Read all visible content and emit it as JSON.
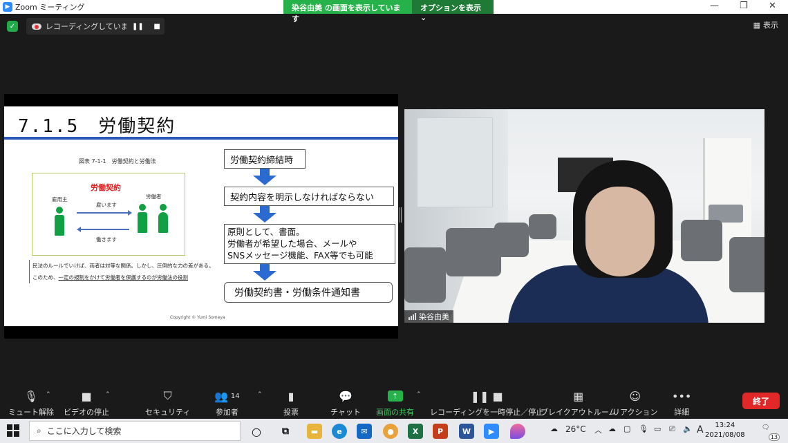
{
  "window": {
    "title": "Zoom ミーティング"
  },
  "share_banner": {
    "who": "染谷由美 の画面を表示しています",
    "options": "オプションを表示"
  },
  "window_controls": {
    "minimize": "—",
    "maximize": "❐",
    "close": "✕"
  },
  "recording": {
    "label": "レコーディングしています...",
    "pause": "❚❚",
    "stop": "■"
  },
  "view": {
    "label": "表示"
  },
  "slide": {
    "title": "7.1.5　労働契約",
    "figure_caption": "図表 7-1-1　労働契約と労働法",
    "contract_label": "労働契約",
    "employer": "雇用主",
    "worker": "労働者",
    "hire": "雇います",
    "work": "働きます",
    "note_line1": "民法のルールでいけば、両者は対等な関係。しかし、圧倒的な力の差がある。",
    "note_line2_prefix": "このため、",
    "note_line2_underline": "一定の規制をかけて労働者を保護するのが労働法の役割",
    "copyright": "Copyright © Yumi Someya",
    "flow": {
      "step1": "労働契約締結時",
      "step2": "契約内容を明示しなければならない",
      "step3_line1": "原則として、書面。",
      "step3_line2": "労働者が希望した場合、メールや",
      "step3_line3": "SNSメッセージ機能、FAX等でも可能",
      "step4": "労働契約書・労働条件通知書"
    }
  },
  "video": {
    "name": "染谷由美"
  },
  "toolbar": {
    "mute": "ミュート解除",
    "video": "ビデオの停止",
    "security": "セキュリティ",
    "participants": "参加者",
    "participant_count": "14",
    "poll": "投票",
    "chat": "チャット",
    "share": "画面の共有",
    "record": "レコーディングを一時停止／停止",
    "breakout": "ブレイクアウトルーム",
    "reaction": "リアクション",
    "more": "詳細",
    "end": "終了"
  },
  "taskbar": {
    "search_placeholder": "ここに入力して検索",
    "weather": "26°C",
    "ime": "A",
    "time": "13:24",
    "date": "2021/08/08",
    "notifications": "13"
  },
  "colors": {
    "zoom_blue": "#2d8cff",
    "share_green": "#27b14a",
    "end_red": "#e02828",
    "slide_rule": "#2b57b8",
    "flow_arrow": "#2b6ad0"
  }
}
